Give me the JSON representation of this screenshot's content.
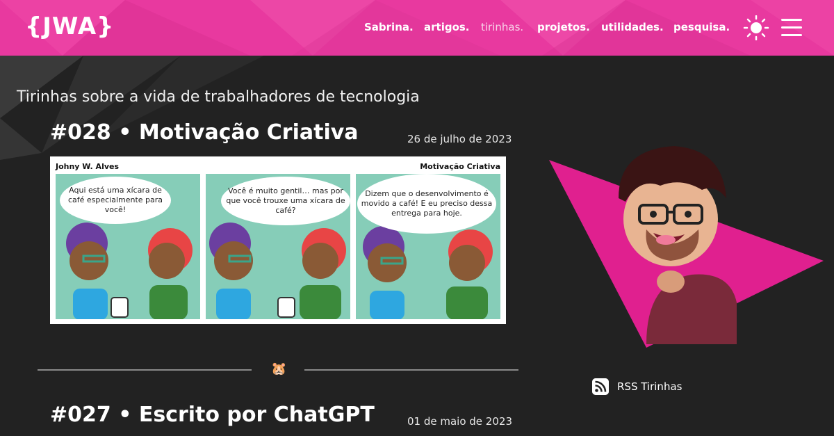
{
  "site": {
    "logo": "{JWA}",
    "nav": [
      {
        "label": "Sabrina.",
        "active": false
      },
      {
        "label": "artigos.",
        "active": false
      },
      {
        "label": "tirinhas.",
        "active": true
      },
      {
        "label": "projetos.",
        "active": false
      },
      {
        "label": "utilidades.",
        "active": false
      },
      {
        "label": "pesquisa.",
        "active": false
      }
    ],
    "theme_icon": "sun-icon",
    "menu_icon": "hamburger-menu-icon",
    "brand_color": "#e8399f",
    "background_color": "#222222"
  },
  "page": {
    "subtitle": "Tirinhas sobre a vida de trabalhadores de tecnologia"
  },
  "posts": [
    {
      "title": "#028 • Motivação Criativa",
      "date": "26 de julho de 2023",
      "comic": {
        "author": "Johny W. Alves",
        "title": "Motivação Criativa",
        "panels": [
          "Aqui está uma xícara de café especialmente para você!",
          "Você é muito gentil… mas por que você trouxe uma xícara de café?",
          "Dizem que o desenvolvimento é movido a café! E eu preciso dessa entrega para hoje."
        ]
      }
    },
    {
      "title": "#027 • Escrito por ChatGPT",
      "date": "01 de maio de 2023"
    }
  ],
  "divider_icon": "🐹",
  "sidebar": {
    "rss_label": "RSS Tirinhas",
    "rss_icon": "rss-icon"
  }
}
